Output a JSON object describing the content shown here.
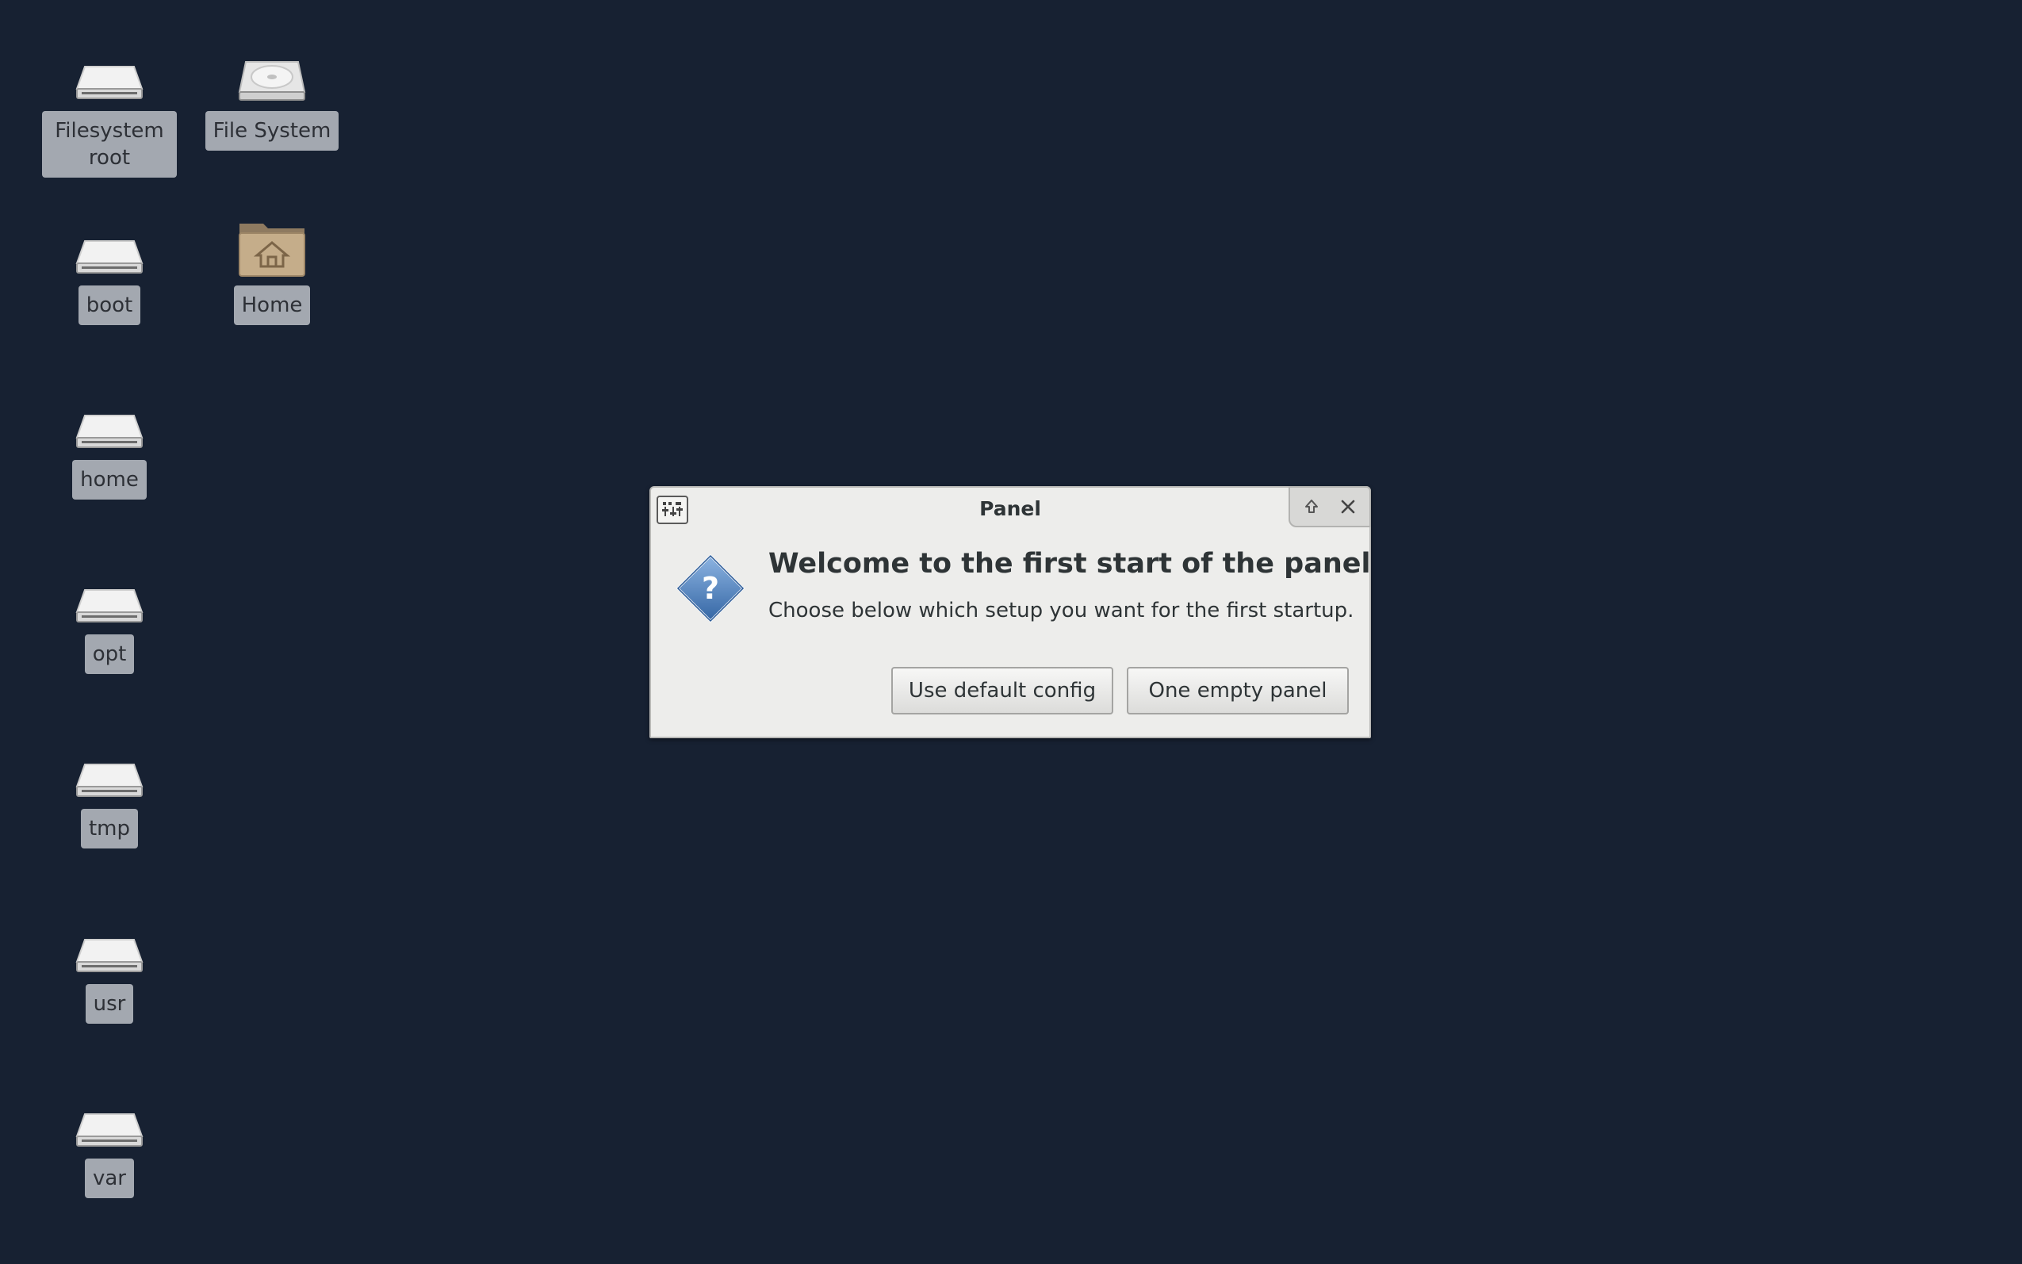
{
  "desktop": {
    "background": "#172132",
    "icons": [
      {
        "label": "Filesystem root",
        "icon": "drive-icon"
      },
      {
        "label": "File System",
        "icon": "hard-disk-icon"
      },
      {
        "label": "boot",
        "icon": "drive-icon"
      },
      {
        "label": "Home",
        "icon": "home-folder-icon"
      },
      {
        "label": "home",
        "icon": "drive-icon"
      },
      {
        "label": "opt",
        "icon": "drive-icon"
      },
      {
        "label": "tmp",
        "icon": "drive-icon"
      },
      {
        "label": "usr",
        "icon": "drive-icon"
      },
      {
        "label": "var",
        "icon": "drive-icon"
      }
    ]
  },
  "dialog": {
    "title": "Panel",
    "app_icon": "panel-preferences-icon",
    "heading": "Welcome to the first start of the panel",
    "message": "Choose below which setup you want for the first startup.",
    "message_icon": "question-icon",
    "buttons": {
      "default_label": "Use default config",
      "empty_label": "One empty panel"
    },
    "window_controls": [
      "roll-up-icon",
      "close-icon"
    ]
  }
}
